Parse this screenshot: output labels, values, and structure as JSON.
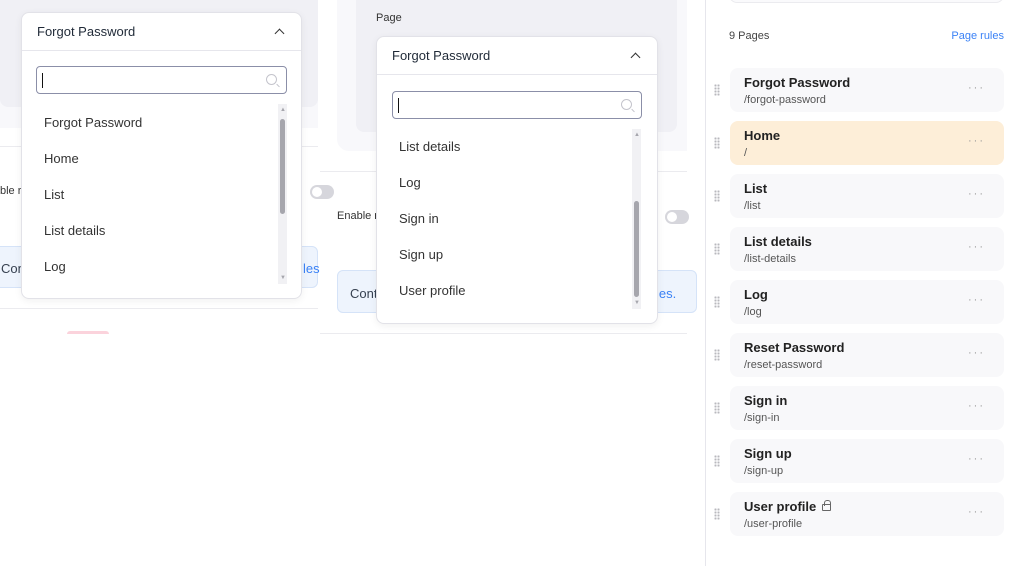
{
  "left_panel": {
    "partial_label": "ble r",
    "info_partial_start": "Conf",
    "info_partial_end": "les",
    "dropdown": {
      "selected": "Forgot Password",
      "search_value": "",
      "options": [
        "Forgot Password",
        "Home",
        "List",
        "List details",
        "Log"
      ]
    }
  },
  "middle_panel": {
    "page_label": "Page",
    "partial_label": "Enable r",
    "info_partial_start": "Cont",
    "info_partial_end": "les.",
    "dropdown": {
      "selected": "Forgot Password",
      "search_value": "",
      "options": [
        "List details",
        "Log",
        "Sign in",
        "Sign up",
        "User profile"
      ]
    }
  },
  "sidebar": {
    "count_label": "9 Pages",
    "page_rules_link": "Page rules",
    "accent": "#3b82f6",
    "active_color": "#fdeed8",
    "pages": [
      {
        "name": "Forgot Password",
        "path": "/forgot-password"
      },
      {
        "name": "Home",
        "path": "/",
        "active": true
      },
      {
        "name": "List",
        "path": "/list"
      },
      {
        "name": "List details",
        "path": "/list-details"
      },
      {
        "name": "Log",
        "path": "/log"
      },
      {
        "name": "Reset Password",
        "path": "/reset-password"
      },
      {
        "name": "Sign in",
        "path": "/sign-in"
      },
      {
        "name": "Sign up",
        "path": "/sign-up"
      },
      {
        "name": "User profile",
        "path": "/user-profile",
        "locked": true
      }
    ]
  }
}
